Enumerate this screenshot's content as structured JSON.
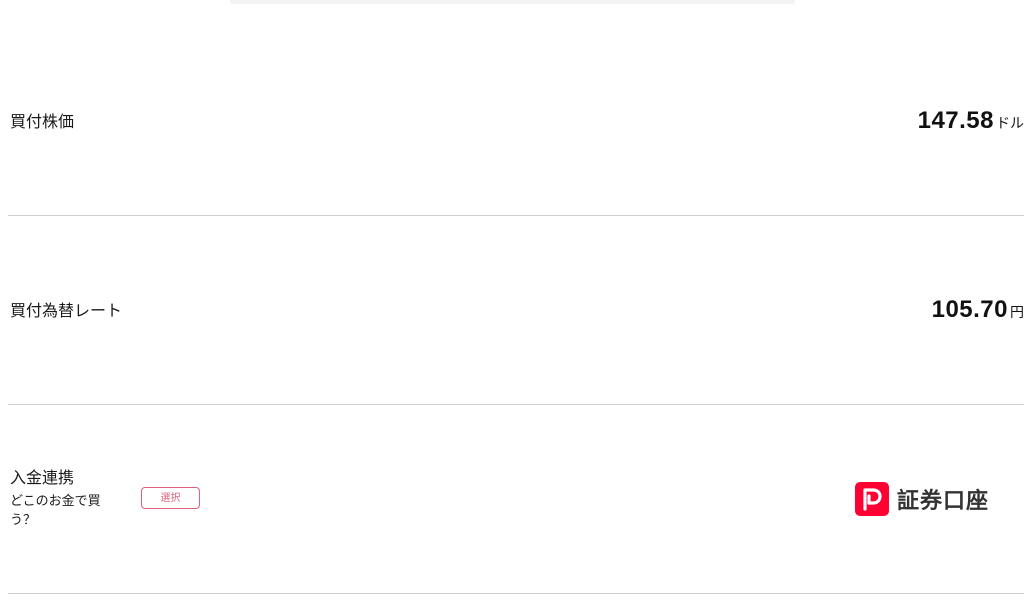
{
  "purchase_price": {
    "label": "買付株価",
    "value": "147.58",
    "unit": "ドル"
  },
  "exchange_rate": {
    "label": "買付為替レート",
    "value": "105.70",
    "unit": "円"
  },
  "deposit_link": {
    "title": "入金連携",
    "subtitle": "どこのお金で買う？",
    "select_label": "選択",
    "account_label": "証券口座",
    "logo_icon": "paypay-logo-icon",
    "logo_color": "#ff0033"
  }
}
